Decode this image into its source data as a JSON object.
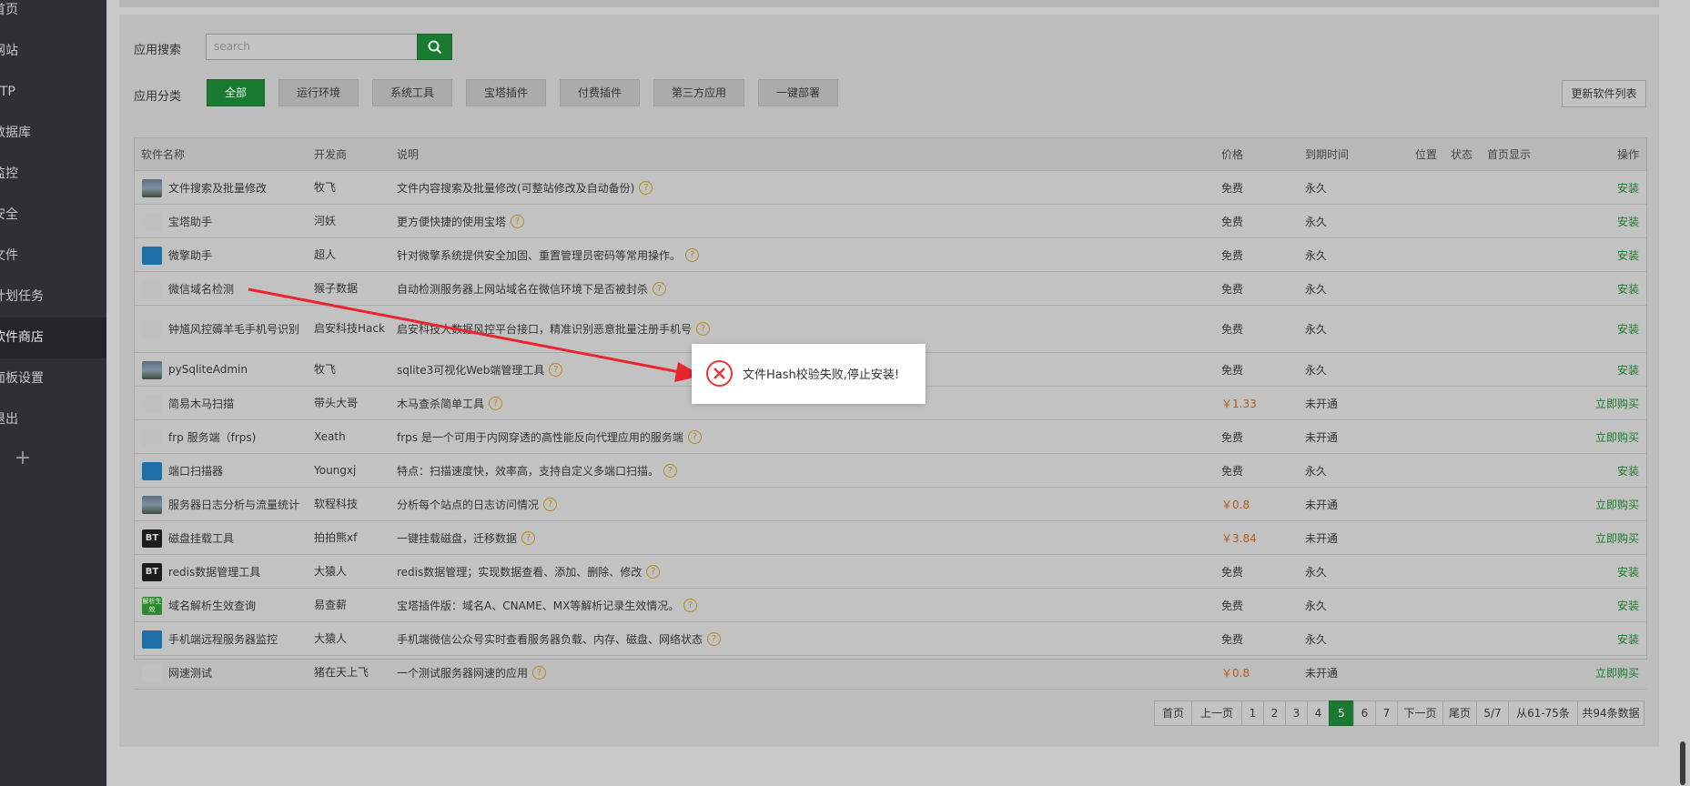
{
  "sidebar": {
    "items": [
      {
        "label": "首页"
      },
      {
        "label": "网站"
      },
      {
        "label": "FTP"
      },
      {
        "label": "数据库"
      },
      {
        "label": "监控"
      },
      {
        "label": "安全"
      },
      {
        "label": "文件"
      },
      {
        "label": "计划任务"
      },
      {
        "label": "软件商店",
        "active": true
      },
      {
        "label": "面板设置"
      },
      {
        "label": "退出"
      }
    ],
    "add_label": "+"
  },
  "search": {
    "label": "应用搜索",
    "placeholder": "search"
  },
  "categories": {
    "label": "应用分类",
    "items": [
      "全部",
      "运行环境",
      "系统工具",
      "宝塔插件",
      "付费插件",
      "第三方应用",
      "一键部署"
    ],
    "active_index": 0
  },
  "update_button": "更新软件列表",
  "table": {
    "headers": {
      "name": "软件名称",
      "developer": "开发商",
      "description": "说明",
      "price": "价格",
      "expire": "到期时间",
      "position": "位置",
      "status": "状态",
      "homepage": "首页显示",
      "action": "操作"
    },
    "rows": [
      {
        "icon": "image-icon",
        "name": "文件搜索及批量修改",
        "developer": "牧飞",
        "description": "文件内容搜索及批量修改(可整站修改及自动备份)",
        "price": "免费",
        "expire": "永久",
        "action": "安装"
      },
      {
        "icon": "helper-icon",
        "name": "宝塔助手",
        "developer": "河妖",
        "description": "更方便快捷的使用宝塔",
        "price": "免费",
        "expire": "永久",
        "action": "安装"
      },
      {
        "icon": "wrench-icon",
        "name": "微擎助手",
        "developer": "超人",
        "description": "针对微擎系统提供安全加固、重置管理员密码等常用操作。",
        "price": "免费",
        "expire": "永久",
        "action": "安装"
      },
      {
        "icon": "detect-icon",
        "name": "微信域名检测",
        "developer": "猴子数据",
        "description": "自动检测服务器上网站域名在微信环境下是否被封杀",
        "price": "免费",
        "expire": "永久",
        "action": "安装"
      },
      {
        "icon": "risk-icon",
        "name": "钟馗风控薅羊毛手机号识别",
        "developer": "启安科技Hack",
        "description": "启安科技大数据风控平台接口，精准识别恶意批量注册手机号",
        "price": "免费",
        "expire": "永久",
        "action": "安装"
      },
      {
        "icon": "image-icon",
        "name": "pySqliteAdmin",
        "developer": "牧飞",
        "description": "sqlite3可视化Web端管理工具",
        "price": "免费",
        "expire": "永久",
        "action": "安装"
      },
      {
        "icon": "target-icon",
        "name": "简易木马扫描",
        "developer": "带头大哥",
        "description": "木马查杀简单工具",
        "price": "￥1.33",
        "paid": true,
        "expire": "未开通",
        "action": "立即购买"
      },
      {
        "icon": "cloud-icon",
        "name": "frp 服务端（frps)",
        "developer": "Xeath",
        "description": "frps 是一个可用于内网穿透的高性能反向代理应用的服务端",
        "price": "免费",
        "expire": "未开通",
        "action": "立即购买"
      },
      {
        "icon": "scan-icon",
        "name": "端口扫描器",
        "developer": "Youngxj",
        "description": "特点：扫描速度快，效率高，支持自定义多端口扫描。",
        "price": "免费",
        "expire": "永久",
        "action": "安装"
      },
      {
        "icon": "chart-icon",
        "name": "服务器日志分析与流量统计",
        "developer": "软程科技",
        "description": "分析每个站点的日志访问情况",
        "price": "￥0.8",
        "paid": true,
        "expire": "未开通",
        "action": "立即购买"
      },
      {
        "icon": "bt-icon",
        "icon_text": "BT",
        "name": "磁盘挂载工具",
        "developer": "拍拍熊xf",
        "description": "一键挂载磁盘，迁移数据",
        "price": "￥3.84",
        "paid": true,
        "expire": "未开通",
        "action": "立即购买"
      },
      {
        "icon": "bt-icon",
        "icon_text": "BT",
        "name": "redis数据管理工具",
        "developer": "大猿人",
        "description": "redis数据管理；实现数据查看、添加、删除、修改",
        "price": "免费",
        "expire": "永久",
        "action": "安装"
      },
      {
        "icon": "dns-icon",
        "icon_text": "解析生效",
        "name": "域名解析生效查询",
        "developer": "易查薪",
        "description": "宝塔插件版：域名A、CNAME、MX等解析记录生效情况。",
        "price": "免费",
        "expire": "永久",
        "action": "安装"
      },
      {
        "icon": "monitor-icon",
        "name": "手机端远程服务器监控",
        "developer": "大猿人",
        "description": "手机端微信公众号实时查看服务器负载、内存、磁盘、网络状态",
        "price": "免费",
        "expire": "永久",
        "action": "安装"
      },
      {
        "icon": "speed-icon",
        "name": "网速测试",
        "developer": "猪在天上飞",
        "description": "一个测试服务器网速的应用",
        "price": "￥0.8",
        "paid": true,
        "expire": "未开通",
        "action": "立即购买"
      }
    ],
    "help_glyph": "?"
  },
  "pagination": {
    "items": [
      "首页",
      "上一页",
      "1",
      "2",
      "3",
      "4",
      "5",
      "6",
      "7",
      "下一页",
      "尾页",
      "5/7",
      "从61-75条",
      "共94条数据"
    ],
    "active": "5"
  },
  "alert": {
    "message": "文件Hash校验失败,停止安装!",
    "icon": "error-circle-icon"
  },
  "colors": {
    "accent": "#20a53a",
    "paid": "#e07b1d",
    "error": "#e6353b",
    "annotation_arrow": "#e8262f"
  }
}
